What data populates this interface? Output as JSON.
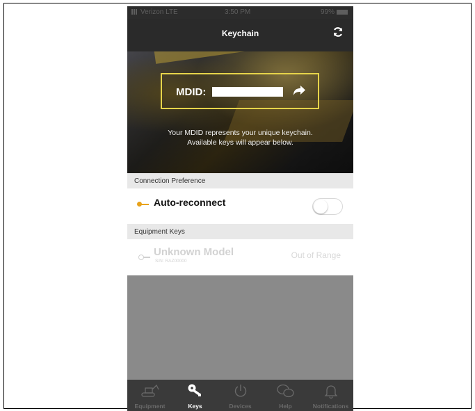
{
  "status_bar": {
    "carrier": "Verizon  LTE",
    "time": "3:50 PM",
    "battery": "99%"
  },
  "nav": {
    "title": "Keychain",
    "refresh_icon": "refresh-icon"
  },
  "hero": {
    "mdid_label": "MDID:",
    "description_line1": "Your MDID represents your unique keychain.",
    "description_line2": "Available keys will appear below."
  },
  "connection": {
    "section_title": "Connection Preference",
    "auto_reconnect_label": "Auto-reconnect",
    "auto_reconnect_on": false
  },
  "equipment": {
    "section_title": "Equipment Keys",
    "items": [
      {
        "name": "Unknown Model",
        "serial": "S/N: RAZ00000",
        "status": "Out of Range"
      }
    ]
  },
  "tabs": [
    {
      "label": "Equipment",
      "icon": "excavator-icon",
      "active": false
    },
    {
      "label": "Keys",
      "icon": "keys-icon",
      "active": true
    },
    {
      "label": "Devices",
      "icon": "power-icon",
      "active": false
    },
    {
      "label": "Help",
      "icon": "chat-bubbles-icon",
      "active": false
    },
    {
      "label": "Notifications",
      "icon": "bell-icon",
      "active": false
    }
  ],
  "colors": {
    "accent_yellow": "#e6d44a",
    "key_gold": "#e8a21a",
    "tab_active": "#ffffff",
    "tab_inactive": "#6a6a6a"
  }
}
